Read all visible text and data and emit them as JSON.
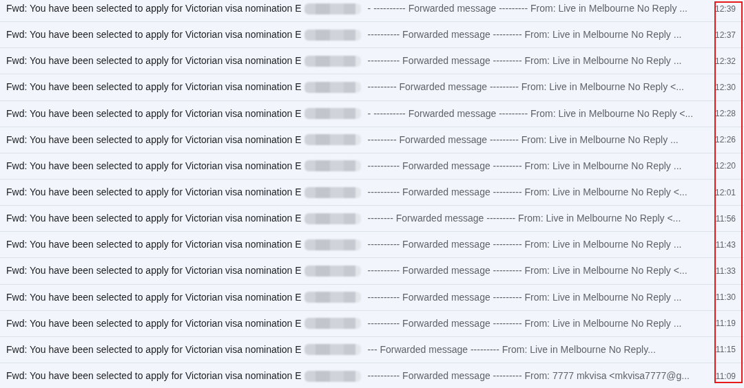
{
  "annotation": {
    "kind": "outline"
  },
  "emails": [
    {
      "subject": "Fwd: You have been selected to apply for Victorian visa nomination E",
      "redacted": true,
      "snippet": "- ---------- Forwarded message --------- From: Live in Melbourne No Reply ...",
      "time": "12:39"
    },
    {
      "subject": "Fwd: You have been selected to apply for Victorian visa nomination E",
      "redacted": true,
      "snippet": "---------- Forwarded message --------- From: Live in Melbourne No Reply ...",
      "time": "12:37"
    },
    {
      "subject": "Fwd: You have been selected to apply for Victorian visa nomination E",
      "redacted": true,
      "snippet": "---------- Forwarded message --------- From: Live in Melbourne No Reply ...",
      "time": "12:32"
    },
    {
      "subject": "Fwd: You have been selected to apply for Victorian visa nomination E",
      "redacted": true,
      "snippet": "--------- Forwarded message --------- From: Live in Melbourne No Reply <...",
      "time": "12:30"
    },
    {
      "subject": "Fwd: You have been selected to apply for Victorian visa nomination E",
      "redacted": true,
      "snippet": "- ---------- Forwarded message --------- From: Live in Melbourne No Reply <...",
      "time": "12:28"
    },
    {
      "subject": "Fwd: You have been selected to apply for Victorian visa nomination E",
      "redacted": true,
      "snippet": "--------- Forwarded message --------- From: Live in Melbourne No Reply ...",
      "time": "12:26"
    },
    {
      "subject": "Fwd: You have been selected to apply for Victorian visa nomination E",
      "redacted": true,
      "snippet": "---------- Forwarded message --------- From: Live in Melbourne No Reply ...",
      "time": "12:20"
    },
    {
      "subject": "Fwd: You have been selected to apply for Victorian visa nomination E",
      "redacted": true,
      "snippet": "---------- Forwarded message --------- From: Live in Melbourne No Reply <...",
      "time": "12:01"
    },
    {
      "subject": "Fwd: You have been selected to apply for Victorian visa nomination E",
      "redacted": true,
      "snippet": "-------- Forwarded message --------- From: Live in Melbourne No Reply <...",
      "time": "11:56"
    },
    {
      "subject": "Fwd: You have been selected to apply for Victorian visa nomination E",
      "redacted": true,
      "snippet": "---------- Forwarded message --------- From: Live in Melbourne No Reply ...",
      "time": "11:43"
    },
    {
      "subject": "Fwd: You have been selected to apply for Victorian visa nomination E",
      "redacted": true,
      "snippet": "---------- Forwarded message --------- From: Live in Melbourne No Reply <...",
      "time": "11:33"
    },
    {
      "subject": "Fwd: You have been selected to apply for Victorian visa nomination E",
      "redacted": true,
      "snippet": "---------- Forwarded message --------- From: Live in Melbourne No Reply ...",
      "time": "11:30"
    },
    {
      "subject": "Fwd: You have been selected to apply for Victorian visa nomination E",
      "redacted": true,
      "snippet": "---------- Forwarded message --------- From: Live in Melbourne No Reply ...",
      "time": "11:19"
    },
    {
      "subject": "Fwd: You have been selected to apply for Victorian visa nomination E",
      "redacted": true,
      "snippet": "--- Forwarded message --------- From: Live in Melbourne No Reply...",
      "time": "11:15"
    },
    {
      "subject": "Fwd: You have been selected to apply for Victorian visa nomination E",
      "redacted": true,
      "snippet": "---------- Forwarded message --------- From: 7777 mkvisa <mkvisa7777@g...",
      "time": "11:09"
    }
  ]
}
